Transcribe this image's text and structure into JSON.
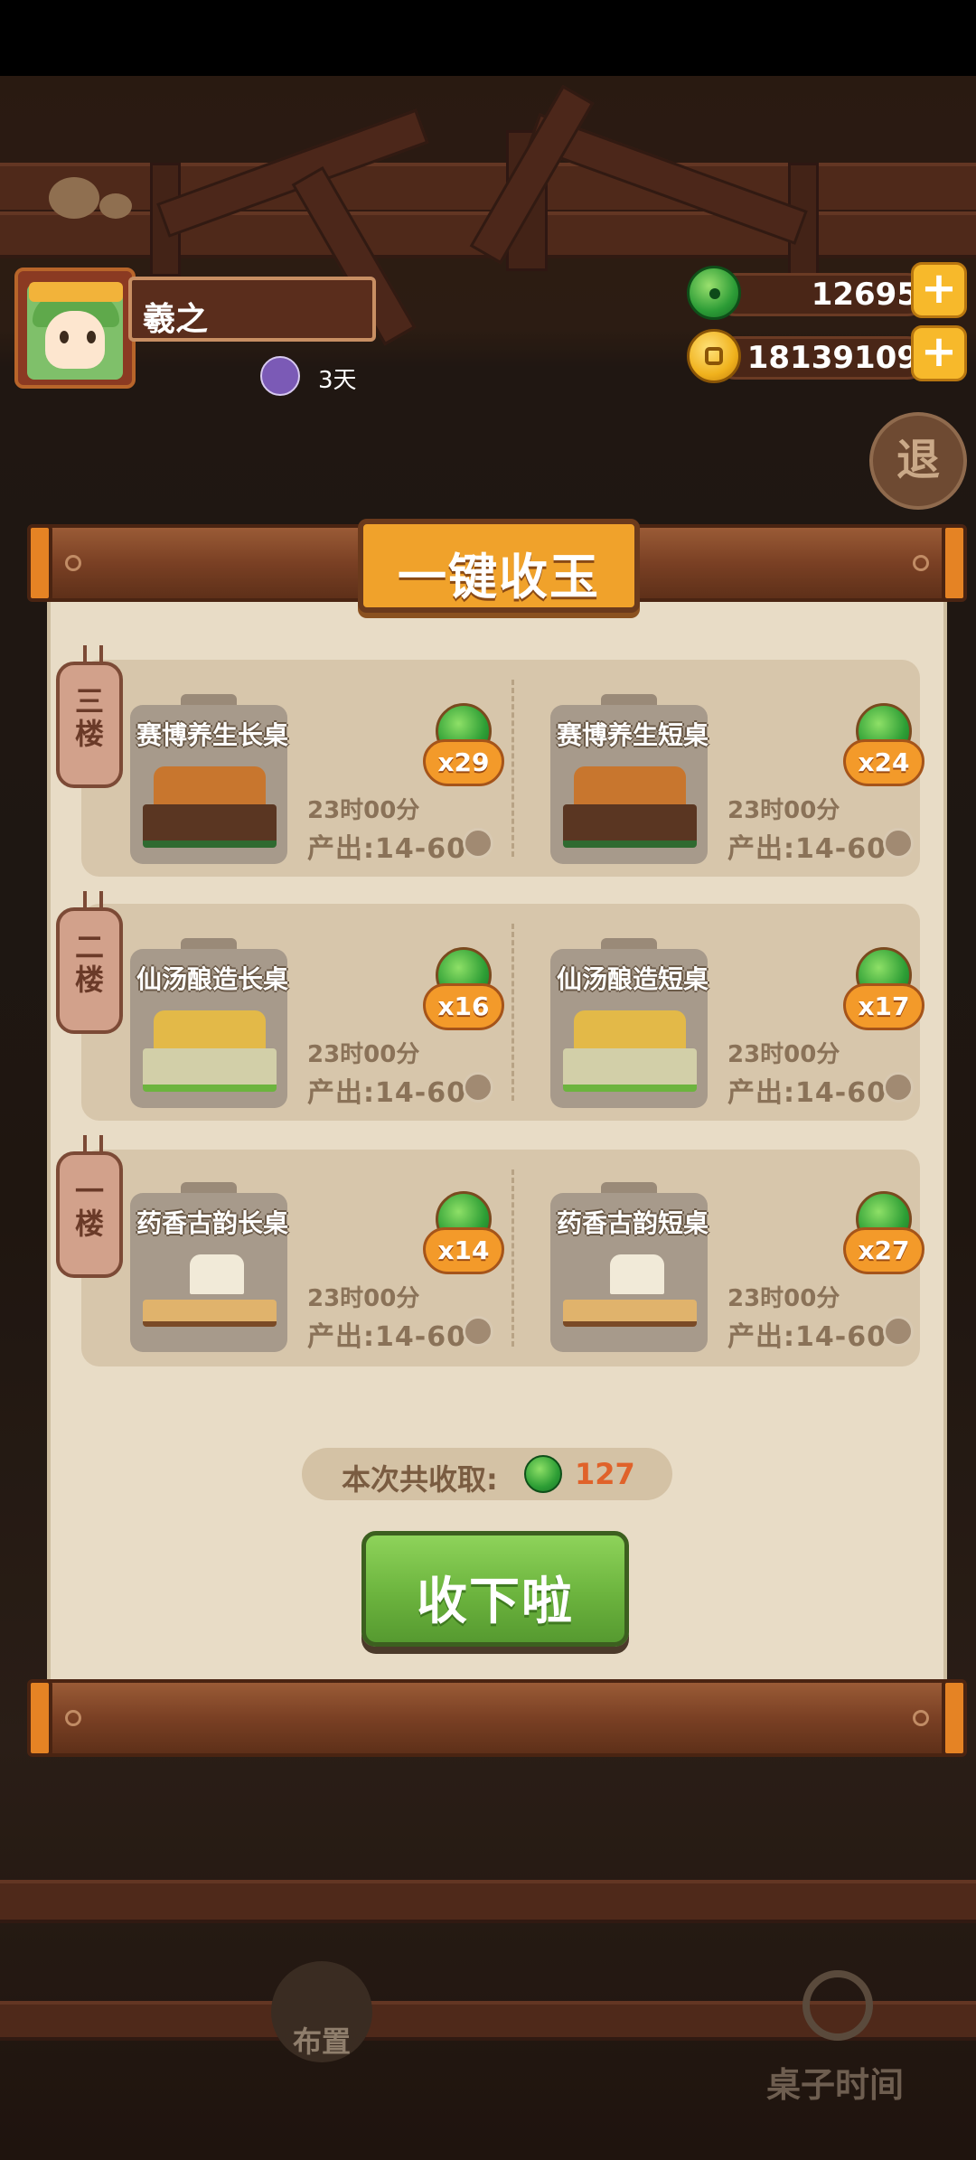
{
  "player": {
    "name": "羲之",
    "days": "3天"
  },
  "currency": {
    "jade": "12695",
    "gold": "18139109"
  },
  "back_button": "退",
  "dialog": {
    "title": "一键收玉",
    "floors": [
      {
        "label": "三楼",
        "tables": [
          {
            "name": "赛博养生长桌",
            "count": "x29",
            "time": "23时00分",
            "output": "产出:14-60"
          },
          {
            "name": "赛博养生短桌",
            "count": "x24",
            "time": "23时00分",
            "output": "产出:14-60"
          }
        ]
      },
      {
        "label": "二楼",
        "tables": [
          {
            "name": "仙汤酿造长桌",
            "count": "x16",
            "time": "23时00分",
            "output": "产出:14-60"
          },
          {
            "name": "仙汤酿造短桌",
            "count": "x17",
            "time": "23时00分",
            "output": "产出:14-60"
          }
        ]
      },
      {
        "label": "一楼",
        "tables": [
          {
            "name": "药香古韵长桌",
            "count": "x14",
            "time": "23时00分",
            "output": "产出:14-60"
          },
          {
            "name": "药香古韵短桌",
            "count": "x27",
            "time": "23时00分",
            "output": "产出:14-60"
          }
        ]
      }
    ],
    "total_label": "本次共收取:",
    "total_value": "127",
    "collect_button": "收下啦"
  },
  "bottom": {
    "layout_button": "布置",
    "table_time_button": "桌子时间"
  },
  "icons": {
    "jade": "jade-icon",
    "gold": "gold-coin-icon",
    "plus": "plus-icon",
    "clock": "clock-icon"
  },
  "colors": {
    "panel_paper": "#e8dcc6",
    "title_plate": "#f0a22b",
    "collect_green": "#6cb43e",
    "total_orange": "#e0622a"
  }
}
